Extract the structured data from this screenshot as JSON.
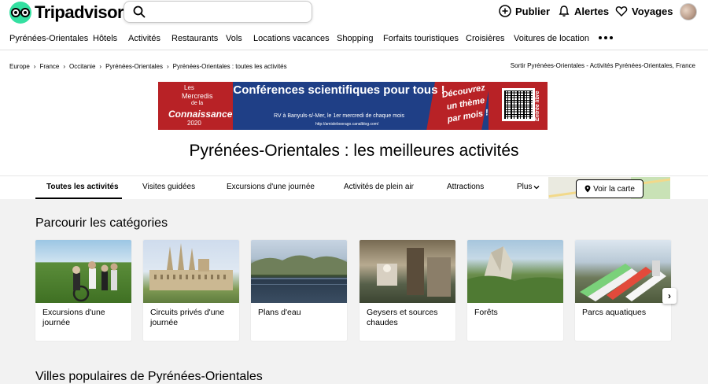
{
  "brand": {
    "name": "Tripadvisor",
    "accent": "#34e0a1"
  },
  "search": {
    "placeholder": "",
    "value": ""
  },
  "header_actions": [
    {
      "label": "Publier",
      "icon": "plus-circle-icon"
    },
    {
      "label": "Alertes",
      "icon": "bell-icon"
    },
    {
      "label": "Voyages",
      "icon": "heart-icon"
    }
  ],
  "nav": {
    "items": [
      "Pyrénées-Orientales",
      "Hôtels",
      "Activités",
      "Restaurants",
      "Vols",
      "Locations vacances",
      "Shopping",
      "Forfaits touristiques",
      "Croisières",
      "Voitures de location"
    ],
    "more_icon": "ellipsis-icon"
  },
  "breadcrumb": {
    "items": [
      "Europe",
      "France",
      "Occitanie",
      "Pyrénées-Orientales",
      "Pyrénées-Orientales : toutes les activités"
    ],
    "right_text": "Sortir Pyrénées-Orientales - Activités Pyrénées-Orientales, France"
  },
  "banner": {
    "line1": "Les",
    "line2": "Mercredis",
    "line3": "de la",
    "line4": "Connaissance",
    "line5": "2020",
    "headline": "Conférences scientifiques pour tous !",
    "subline": "RV à Banyuls-s/-Mer, le 1er mercredi de chaque mois",
    "url": "http://amisleboorago.canalblog.com/",
    "script": "Découvrez un thème par mois !",
    "side": "Entrée libre"
  },
  "page": {
    "title": "Pyrénées-Orientales : les meilleures activités"
  },
  "tabs": {
    "items": [
      "Toutes les activités",
      "Visites guidées",
      "Excursions d'une journée",
      "Activités de plein air",
      "Attractions"
    ],
    "more_label": "Plus",
    "map_button": "Voir la carte"
  },
  "categories": {
    "title": "Parcourir les catégories",
    "items": [
      "Excursions d'une journée",
      "Circuits privés d'une journée",
      "Plans d'eau",
      "Geysers et sources chaudes",
      "Forêts",
      "Parcs aquatiques"
    ]
  },
  "popular": {
    "title": "Villes populaires de Pyrénées-Orientales"
  }
}
